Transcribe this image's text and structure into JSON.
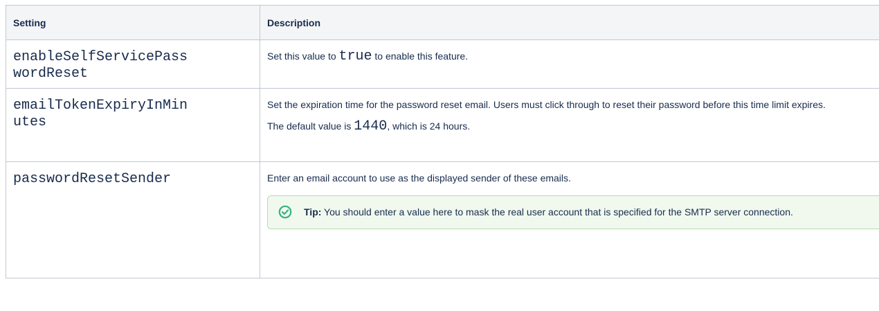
{
  "table": {
    "headers": {
      "setting": "Setting",
      "description": "Description"
    },
    "rows": [
      {
        "setting_line1": "enableSelfServicePass",
        "setting_line2": "wordReset",
        "desc_prefix": "Set this value to ",
        "desc_code": "true",
        "desc_suffix": " to enable this feature."
      },
      {
        "setting_line1": "emailTokenExpiryInMin",
        "setting_line2": "utes",
        "desc_para1": "Set the expiration time for the password reset email. Users must click through to reset their password before this time limit expires.",
        "desc_para2_prefix": "The default value is ",
        "desc_para2_code": "1440",
        "desc_para2_suffix": ", which is 24 hours."
      },
      {
        "setting": "passwordResetSender",
        "desc_para1": "Enter an email account to use as the displayed sender of these emails.",
        "tip": {
          "label": "Tip:",
          "text": " You should enter a value here to mask the real user account that is specified for the SMTP server connection.",
          "icon": "check-circle-icon",
          "color": "#36b37e"
        }
      }
    ]
  }
}
